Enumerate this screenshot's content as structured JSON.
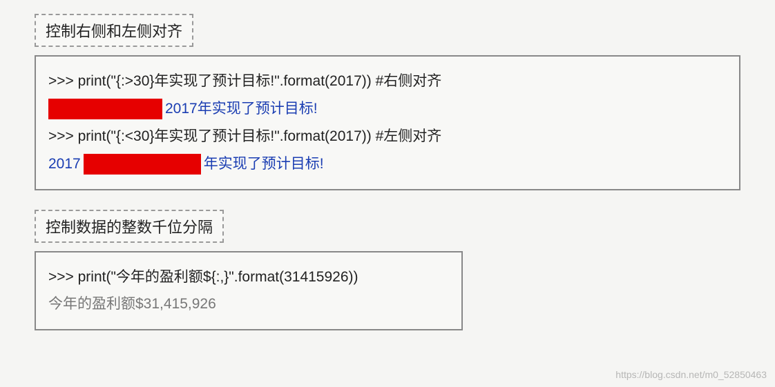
{
  "section1": {
    "title": "控制右侧和左侧对齐",
    "code1": ">>> print(\"{:>30}年实现了预计目标!\".format(2017)) #右侧对齐",
    "output1_tail": "2017年实现了预计目标!",
    "code2": ">>> print(\"{:<30}年实现了预计目标!\".format(2017)) #左侧对齐",
    "output2_head": "2017",
    "output2_tail": "年实现了预计目标!"
  },
  "section2": {
    "title": "控制数据的整数千位分隔",
    "code1": ">>> print(\"今年的盈利额${:,}\".format(31415926))",
    "output1": "今年的盈利额$31,415,926"
  },
  "watermark": "https://blog.csdn.net/m0_52850463"
}
